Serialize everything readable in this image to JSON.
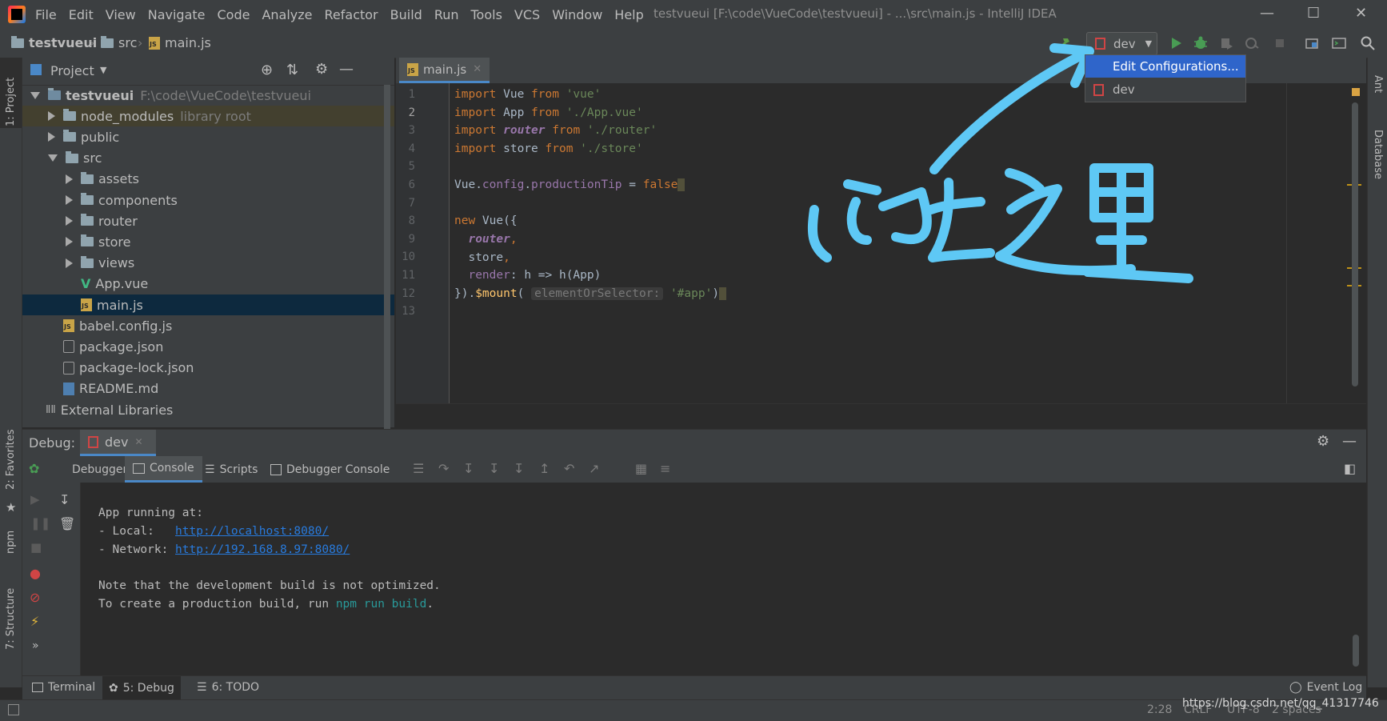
{
  "app": {
    "menu": [
      "File",
      "Edit",
      "View",
      "Navigate",
      "Code",
      "Analyze",
      "Refactor",
      "Build",
      "Run",
      "Tools",
      "VCS",
      "Window",
      "Help"
    ],
    "window_title": "testvueui [F:\\code\\VueCode\\testvueui] - ...\\src\\main.js - IntelliJ IDEA"
  },
  "breadcrumb": [
    "testvueui",
    "src",
    "main.js"
  ],
  "run_config": {
    "selected": "dev",
    "options": [
      "Edit Configurations...",
      "dev"
    ]
  },
  "side_stripes": {
    "left": [
      "1: Project",
      "2: Favorites",
      "npm",
      "7: Structure"
    ],
    "right": [
      "Ant",
      "Database"
    ]
  },
  "project_panel": {
    "title": "Project",
    "tree": [
      {
        "label": "testvueui",
        "hint": "F:\\code\\VueCode\\testvueui",
        "type": "folder",
        "level": 0,
        "expanded": true
      },
      {
        "label": "node_modules",
        "hint": "library root",
        "type": "folder",
        "level": 1,
        "expanded": false
      },
      {
        "label": "public",
        "hint": "",
        "type": "folder",
        "level": 1,
        "expanded": false
      },
      {
        "label": "src",
        "hint": "",
        "type": "folder",
        "level": 1,
        "expanded": true
      },
      {
        "label": "assets",
        "hint": "",
        "type": "folder",
        "level": 2,
        "expanded": false
      },
      {
        "label": "components",
        "hint": "",
        "type": "folder",
        "level": 2,
        "expanded": false
      },
      {
        "label": "router",
        "hint": "",
        "type": "folder",
        "level": 2,
        "expanded": false
      },
      {
        "label": "store",
        "hint": "",
        "type": "folder",
        "level": 2,
        "expanded": false
      },
      {
        "label": "views",
        "hint": "",
        "type": "folder",
        "level": 2,
        "expanded": false
      },
      {
        "label": "App.vue",
        "hint": "",
        "type": "vue",
        "level": 2
      },
      {
        "label": "main.js",
        "hint": "",
        "type": "js",
        "level": 2,
        "selected": true
      },
      {
        "label": "babel.config.js",
        "hint": "",
        "type": "js",
        "level": 1
      },
      {
        "label": "package.json",
        "hint": "",
        "type": "json",
        "level": 1
      },
      {
        "label": "package-lock.json",
        "hint": "",
        "type": "json",
        "level": 1
      },
      {
        "label": "README.md",
        "hint": "",
        "type": "md",
        "level": 1
      },
      {
        "label": "External Libraries",
        "hint": "",
        "type": "lib",
        "level": 0
      }
    ]
  },
  "editor": {
    "tab": "main.js",
    "line_numbers": [
      "1",
      "2",
      "3",
      "4",
      "5",
      "6",
      "7",
      "8",
      "9",
      "10",
      "11",
      "12",
      "13"
    ],
    "param_hint": "elementOrSelector:"
  },
  "debug": {
    "label": "Debug:",
    "session": "dev",
    "tabs": [
      "Debugger",
      "Console",
      "Scripts",
      "Debugger Console"
    ],
    "console": {
      "line1": "App running at:",
      "local_label": "- Local:   ",
      "local_url": "http://localhost:8080/",
      "network_label": "- Network: ",
      "network_url": "http://192.168.8.97:8080/",
      "note": "Note that the development build is not optimized.",
      "build_prefix": "To create a production build, run ",
      "build_cmd": "npm run build",
      "build_suffix": "."
    }
  },
  "bottom_tabs": [
    "Terminal",
    "5: Debug",
    "6: TODO"
  ],
  "event_log": "Event Log",
  "status": {
    "position": "2:28",
    "line_sep": "CRLF",
    "encoding": "UTF-8",
    "indent": "2 spaces",
    "watermark": "https://blog.csdn.net/qq_41317746"
  },
  "annotation_text": "点击这里"
}
